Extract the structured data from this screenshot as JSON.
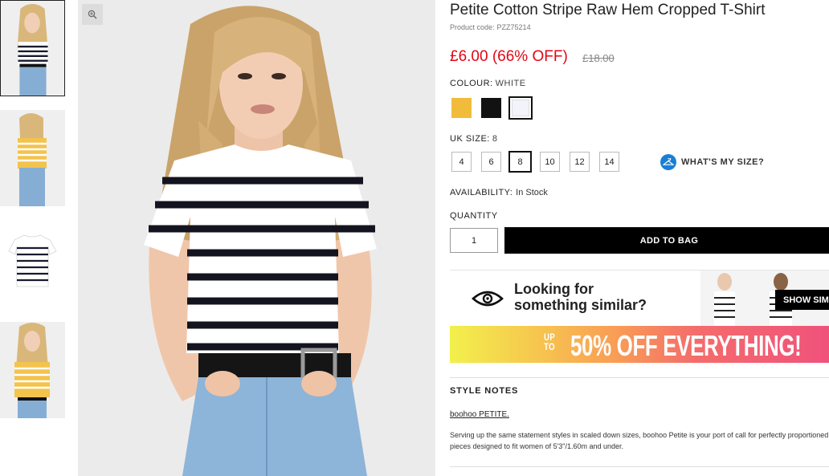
{
  "product": {
    "title": "Petite Cotton Stripe Raw Hem Cropped T-Shirt",
    "code_label": "Product code:",
    "code": "PZZ75214",
    "price": "£6.00 (66% OFF)",
    "was_price": "£18.00"
  },
  "colour": {
    "label": "COLOUR:",
    "selected": "WHITE",
    "swatches": [
      "mustard",
      "black",
      "white"
    ],
    "swatch_colors": {
      "mustard": "#f1bc3c",
      "black": "#121212",
      "white": "#ffffff"
    }
  },
  "size": {
    "label": "UK SIZE:",
    "selected": "8",
    "options": [
      "4",
      "6",
      "8",
      "10",
      "12",
      "14"
    ],
    "whats_my_size": "WHAT'S MY SIZE?"
  },
  "availability": {
    "label": "AVAILABILITY:",
    "value": "In Stock"
  },
  "quantity": {
    "label": "QUANTITY",
    "value": "1"
  },
  "actions": {
    "add_to_bag": "ADD TO BAG"
  },
  "similar": {
    "line1": "Looking for",
    "line2": "something similar?",
    "button": "SHOW SIM"
  },
  "promo": {
    "prefix_top": "UP",
    "prefix_bottom": "TO",
    "text": "50% OFF EVERYTHING!"
  },
  "style_notes": {
    "heading": "STYLE NOTES",
    "brand": "boohoo PETITE.",
    "description": "Serving up the same statement styles in scaled down sizes, boohoo Petite is your port of call for perfectly proportioned pieces designed to fit women of 5'3\"/1.60m and under."
  },
  "colors": {
    "price_red": "#e30613",
    "button_black": "#000000",
    "size_icon_blue": "#1a7fd4"
  }
}
